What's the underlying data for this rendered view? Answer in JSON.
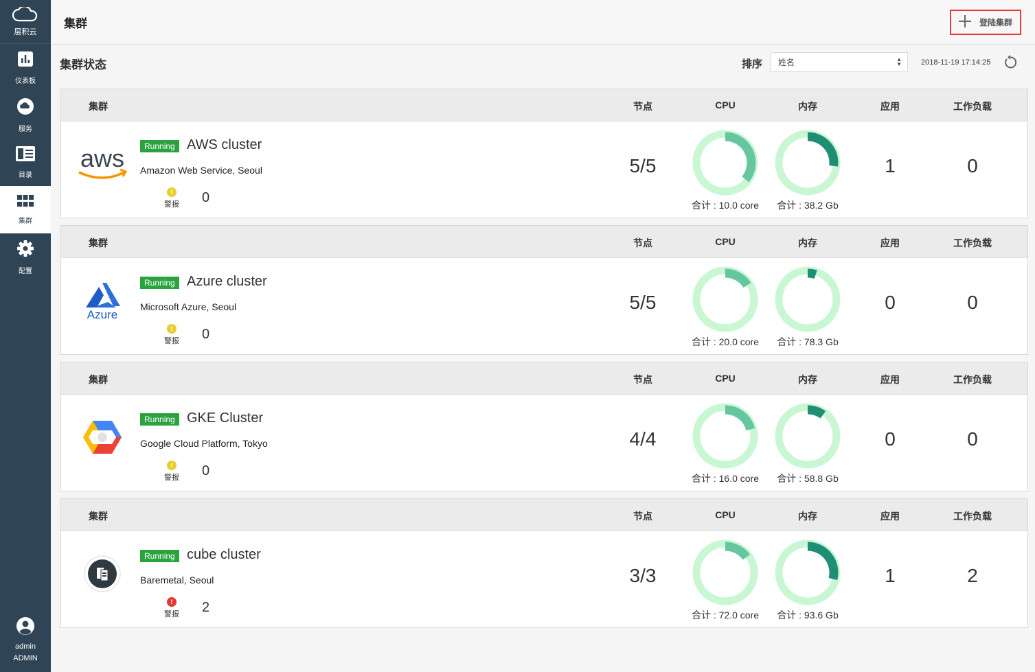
{
  "brand": {
    "name": "层积云"
  },
  "nav": {
    "items": [
      {
        "label": "仪表板",
        "icon": "bar-chart-icon"
      },
      {
        "label": "服务",
        "icon": "cloud-icon"
      },
      {
        "label": "目录",
        "icon": "catalog-icon"
      },
      {
        "label": "集群",
        "icon": "grid-icon"
      },
      {
        "label": "配置",
        "icon": "gear-icon"
      }
    ],
    "active": "集群"
  },
  "user": {
    "name": "admin",
    "role": "ADMIN"
  },
  "header": {
    "title": "集群",
    "add_button_label": "登陆集群"
  },
  "toolbar": {
    "section_title": "集群状态",
    "sort_label": "排序",
    "sort_value": "姓名",
    "timestamp": "2018-11-19 17:14:25"
  },
  "columns": {
    "cluster": "集群",
    "nodes": "节点",
    "cpu": "CPU",
    "memory": "内存",
    "apps": "应用",
    "workloads": "工作负载"
  },
  "alert_label": "警报",
  "colors": {
    "sidebar": "#2f4454",
    "running": "#2aa33f",
    "donut_track": "#c9f7d3",
    "cpu_fill": "#66c6a0",
    "mem_fill": "#1e8f75",
    "highlight": "#e53935",
    "alert_warning": "#e6cf2e",
    "alert_error": "#e53935"
  },
  "clusters": [
    {
      "status": "Running",
      "name": "AWS cluster",
      "provider": "Amazon Web Service, Seoul",
      "logo": "aws-logo",
      "alert_level": "warning",
      "alerts": "0",
      "nodes": "5/5",
      "cpu_usage": 0.36,
      "cpu_total": "合计 : 10.0 core",
      "mem_usage": 0.27,
      "mem_total": "合计 : 38.2 Gb",
      "apps": "1",
      "workloads": "0"
    },
    {
      "status": "Running",
      "name": "Azure cluster",
      "provider": "Microsoft Azure, Seoul",
      "logo": "azure-logo",
      "alert_level": "warning",
      "alerts": "0",
      "nodes": "5/5",
      "cpu_usage": 0.16,
      "cpu_total": "合计 : 20.0 core",
      "mem_usage": 0.05,
      "mem_total": "合计 : 78.3 Gb",
      "apps": "0",
      "workloads": "0"
    },
    {
      "status": "Running",
      "name": "GKE Cluster",
      "provider": "Google Cloud Platform, Tokyo",
      "logo": "gcp-logo",
      "alert_level": "warning",
      "alerts": "0",
      "nodes": "4/4",
      "cpu_usage": 0.21,
      "cpu_total": "合计 : 16.0 core",
      "mem_usage": 0.1,
      "mem_total": "合计 : 58.8 Gb",
      "apps": "0",
      "workloads": "0"
    },
    {
      "status": "Running",
      "name": "cube cluster",
      "provider": "Baremetal, Seoul",
      "logo": "cube-logo",
      "alert_level": "error",
      "alerts": "2",
      "nodes": "3/3",
      "cpu_usage": 0.15,
      "cpu_total": "合计 : 72.0 core",
      "mem_usage": 0.29,
      "mem_total": "合计 : 93.6 Gb",
      "apps": "1",
      "workloads": "2"
    }
  ]
}
